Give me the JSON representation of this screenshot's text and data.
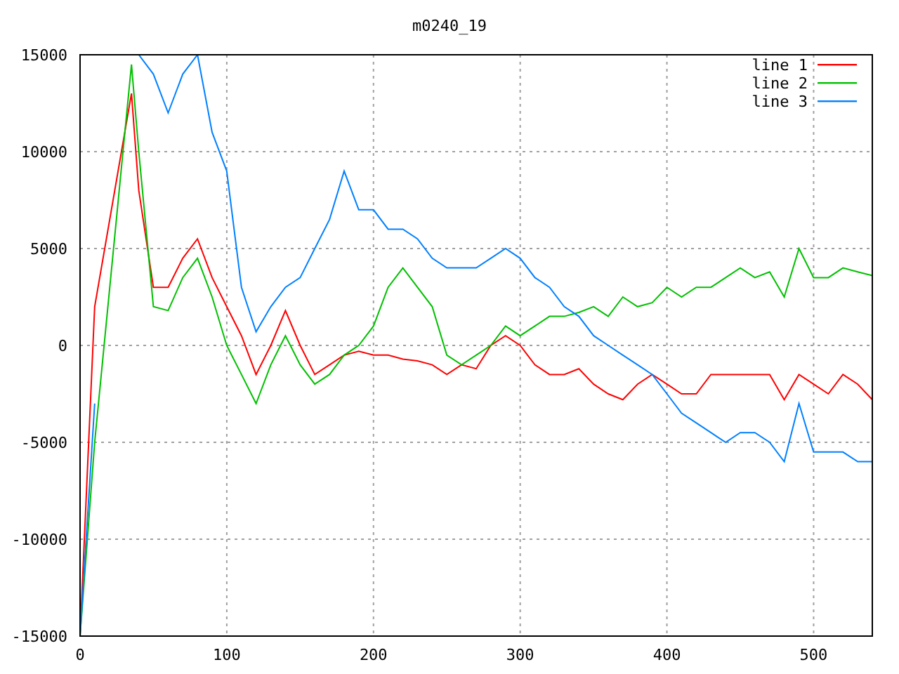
{
  "chart_data": {
    "type": "line",
    "title": "m0240_19",
    "x": [
      0,
      10,
      35,
      40,
      50,
      60,
      70,
      80,
      90,
      100,
      110,
      120,
      130,
      140,
      150,
      160,
      170,
      180,
      190,
      200,
      210,
      220,
      230,
      240,
      250,
      260,
      270,
      280,
      290,
      300,
      310,
      320,
      330,
      340,
      350,
      360,
      370,
      380,
      390,
      400,
      410,
      420,
      430,
      440,
      450,
      460,
      470,
      480,
      490,
      500,
      510,
      520,
      530,
      540
    ],
    "series": [
      {
        "name": "line 1",
        "color": "#ff0000",
        "values": [
          -15000,
          2000,
          13000,
          8000,
          3000,
          3000,
          4500,
          5500,
          3500,
          2000,
          500,
          -1500,
          0,
          1800,
          0,
          -1500,
          -1000,
          -500,
          -300,
          -500,
          -500,
          -700,
          -800,
          -1000,
          -1500,
          -1000,
          -1200,
          0,
          500,
          0,
          -1000,
          -1500,
          -1500,
          -1200,
          -2000,
          -2500,
          -2800,
          -2000,
          -1500,
          -2000,
          -2500,
          -2500,
          -1500,
          -1500,
          -1500,
          -1500,
          -1500,
          -2800,
          -1500,
          -2000,
          -2500,
          -1500,
          -2000,
          -2800
        ]
      },
      {
        "name": "line 2",
        "color": "#00c000",
        "values": [
          -15000,
          -5000,
          14500,
          10000,
          2000,
          1800,
          3500,
          4500,
          2500,
          0,
          -1500,
          -3000,
          -1000,
          500,
          -1000,
          -2000,
          -1500,
          -500,
          0,
          1000,
          3000,
          4000,
          3000,
          2000,
          -500,
          -1000,
          -500,
          0,
          1000,
          500,
          1000,
          1500,
          1500,
          1700,
          2000,
          1500,
          2500,
          2000,
          2200,
          3000,
          2500,
          3000,
          3000,
          3500,
          4000,
          3500,
          3800,
          2500,
          5000,
          3500,
          3500,
          4000,
          3800,
          3600
        ]
      },
      {
        "name": "line 3",
        "color": "#0080ff",
        "values": [
          -15000,
          -3000,
          null,
          15000,
          14000,
          12000,
          14000,
          15000,
          11000,
          9000,
          3000,
          700,
          2000,
          3000,
          3500,
          5000,
          6500,
          9000,
          7000,
          7000,
          6000,
          6000,
          5500,
          4500,
          4000,
          4000,
          4000,
          4500,
          5000,
          4500,
          3500,
          3000,
          2000,
          1500,
          500,
          0,
          -500,
          -1000,
          -1500,
          -2500,
          -3500,
          -4000,
          -4500,
          -5000,
          -4500,
          -4500,
          -5000,
          -6000,
          -3000,
          -5500,
          -5500,
          -5500,
          -6000,
          -6000
        ]
      }
    ],
    "xlim": [
      0,
      540
    ],
    "ylim": [
      -15000,
      15000
    ],
    "xticks": [
      0,
      100,
      200,
      300,
      400,
      500
    ],
    "yticks": [
      -15000,
      -10000,
      -5000,
      0,
      5000,
      10000,
      15000
    ],
    "grid": true,
    "legend": true
  }
}
